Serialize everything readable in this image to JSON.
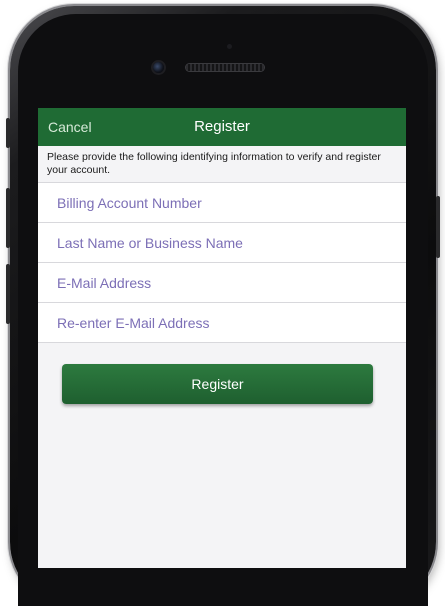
{
  "nav": {
    "cancel_label": "Cancel",
    "title": "Register"
  },
  "form": {
    "instructions": "Please provide the following identifying information to verify and register your account.",
    "fields": [
      {
        "placeholder": "Billing Account Number",
        "value": ""
      },
      {
        "placeholder": "Last Name or Business Name",
        "value": ""
      },
      {
        "placeholder": "E-Mail Address",
        "value": ""
      },
      {
        "placeholder": "Re-enter E-Mail Address",
        "value": ""
      }
    ],
    "submit_label": "Register"
  },
  "colors": {
    "brand_green": "#1f6b34",
    "placeholder_purple": "#7c6fb6"
  }
}
